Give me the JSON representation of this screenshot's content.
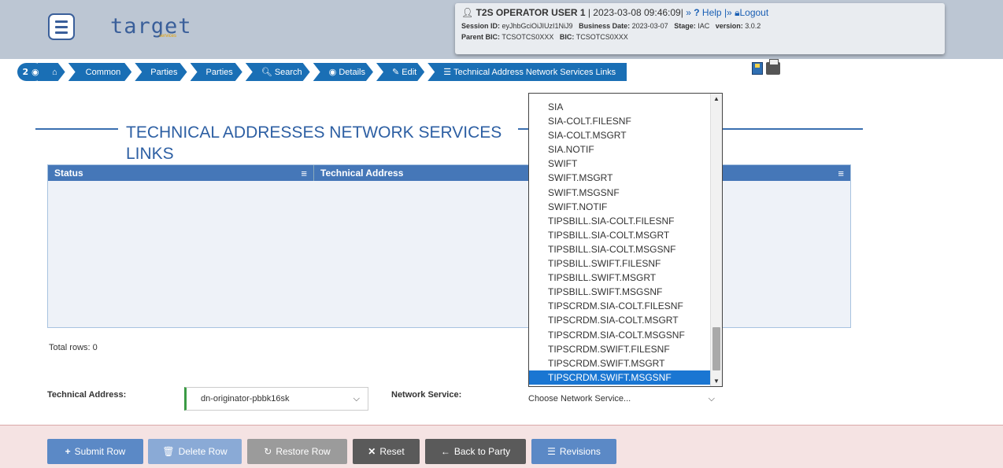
{
  "header": {
    "logo_text": "target",
    "logo_sub": "services",
    "user": {
      "name": "T2S OPERATOR USER 1",
      "datetime": "| 2023-03-08 09:46:09|",
      "sep1": "»",
      "help_label": "Help",
      "sep2": "|»",
      "logout_label": "Logout",
      "session_label": "Session ID:",
      "session_value": "eyJhbGciOiJIUzI1NiJ9",
      "business_date_label": "Business Date:",
      "business_date_value": "2023-03-07",
      "stage_label": "Stage:",
      "stage_value": "IAC",
      "version_label": "version:",
      "version_value": "3.0.2",
      "parent_bic_label": "Parent BIC:",
      "parent_bic_value": "TCSOTCS0XXX",
      "bic_label": "BIC:",
      "bic_value": "TCSOTCS0XXX"
    }
  },
  "breadcrumb": {
    "counter": "2",
    "items": [
      {
        "label": ""
      },
      {
        "label": "Common"
      },
      {
        "label": "Parties"
      },
      {
        "label": "Parties"
      },
      {
        "label": "Search"
      },
      {
        "label": "Details"
      },
      {
        "label": "Edit"
      },
      {
        "label": "Technical Address Network Services Links"
      }
    ]
  },
  "page_title": "TECHNICAL ADDRESSES NETWORK SERVICES LINKS",
  "table": {
    "columns": [
      {
        "label": "Status"
      },
      {
        "label": "Technical Address"
      },
      {
        "label": ""
      }
    ],
    "rows": []
  },
  "total_rows": "Total rows: 0",
  "form": {
    "technical_address_label": "Technical Address:",
    "technical_address_value": "dn-originator-pbbk16sk",
    "network_service_label": "Network Service:",
    "network_service_value": "Choose Network Service..."
  },
  "network_service_options": [
    "SIA",
    "SIA-COLT.FILESNF",
    "SIA-COLT.MSGRT",
    "SIA.NOTIF",
    "SWIFT",
    "SWIFT.MSGRT",
    "SWIFT.MSGSNF",
    "SWIFT.NOTIF",
    "TIPSBILL.SIA-COLT.FILESNF",
    "TIPSBILL.SIA-COLT.MSGRT",
    "TIPSBILL.SIA-COLT.MSGSNF",
    "TIPSBILL.SWIFT.FILESNF",
    "TIPSBILL.SWIFT.MSGRT",
    "TIPSBILL.SWIFT.MSGSNF",
    "TIPSCRDM.SIA-COLT.FILESNF",
    "TIPSCRDM.SIA-COLT.MSGRT",
    "TIPSCRDM.SIA-COLT.MSGSNF",
    "TIPSCRDM.SWIFT.FILESNF",
    "TIPSCRDM.SWIFT.MSGRT",
    "TIPSCRDM.SWIFT.MSGSNF"
  ],
  "selected_option": "TIPSCRDM.SWIFT.MSGSNF",
  "footer": {
    "submit_label": "Submit Row",
    "delete_label": "Delete Row",
    "restore_label": "Restore Row",
    "reset_label": "Reset",
    "back_label": "Back to Party",
    "revisions_label": "Revisions"
  },
  "icons": {
    "menu": "hamburger-icon",
    "home": "home-icon",
    "eye": "eye-icon",
    "search": "search-icon",
    "edit": "edit-icon",
    "list": "list-icon",
    "save": "save-icon",
    "print": "print-icon"
  },
  "colors": {
    "accent": "#1a6fb5",
    "header_bg": "#bcc6d3",
    "selected": "#1a76d2",
    "footer_bg": "#f5e3e3"
  }
}
